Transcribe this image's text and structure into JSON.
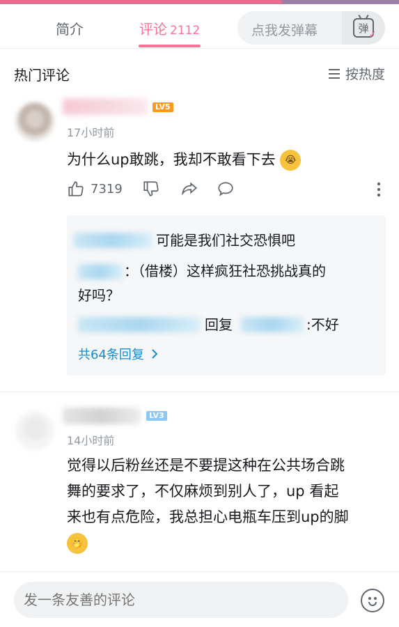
{
  "tabs": {
    "intro_label": "简介",
    "comments_label": "评论",
    "comments_count": "2112",
    "danmaku_placeholder": "点我发弹幕",
    "danmaku_icon_char": "弹"
  },
  "section": {
    "title": "热门评论",
    "sort_label": "按热度"
  },
  "comments": [
    {
      "level": "LV5",
      "time": "17小时前",
      "content": "为什么up敢跳，我却不敢看下去",
      "likes": "7319",
      "replies": {
        "r1_text": "可能是我们社交恐惧吧",
        "r2_text_a": "：（借楼）这样疯狂社恐挑战真的",
        "r2_text_b": "好吗？",
        "r3_mid": "回复",
        "r3_end": ":不好",
        "more_label": "共64条回复"
      }
    },
    {
      "level": "LV3",
      "time": "14小时前",
      "content_line1": "觉得以后粉丝还是不要提这种在公共场合跳",
      "content_line2": "舞的要求了，不仅麻烦到别人了，up 看起",
      "content_line3": "来也有点危险，我总担心电瓶车压到up的脚"
    }
  ],
  "bottom": {
    "input_placeholder": "发一条友善的评论"
  },
  "colors": {
    "accent": "#fb7299",
    "link": "#178bcf",
    "text": "#18191c",
    "muted": "#9499a0"
  }
}
